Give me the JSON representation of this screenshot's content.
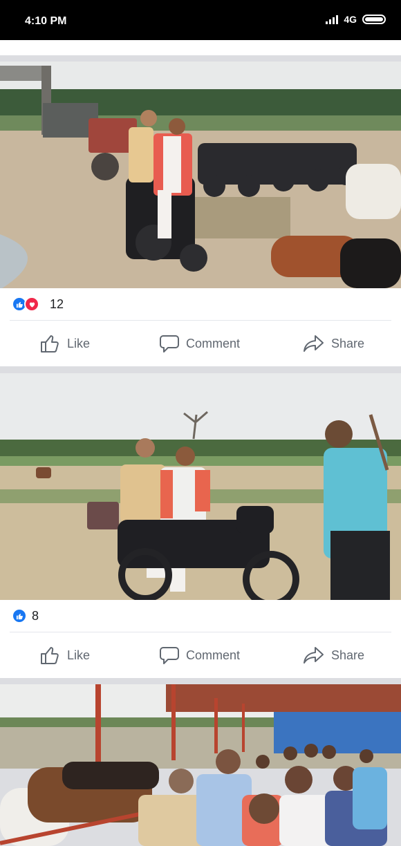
{
  "status_bar": {
    "time": "4:10 PM",
    "network": "4G",
    "battery_level": 1.0
  },
  "posts": [
    {
      "photo_alt": "Two men riding a motorcycle past parked bikes and cows",
      "reaction_count": "12",
      "reaction_types": [
        "like-icon",
        "love-icon"
      ],
      "actions": {
        "like": "Like",
        "comment": "Comment",
        "share": "Share"
      }
    },
    {
      "photo_alt": "Two men on a motorcycle with a man in a blue shirt standing nearby",
      "reaction_count": "8",
      "reaction_types": [
        "like-icon"
      ],
      "actions": {
        "like": "Like",
        "comment": "Comment",
        "share": "Share"
      }
    },
    {
      "photo_alt": "Group of people standing in a cow shed"
    }
  ],
  "colors": {
    "facebook_blue": "#1877f2",
    "love_red": "#f0284a",
    "action_gray": "#606770",
    "feed_background": "#dcdde1"
  }
}
